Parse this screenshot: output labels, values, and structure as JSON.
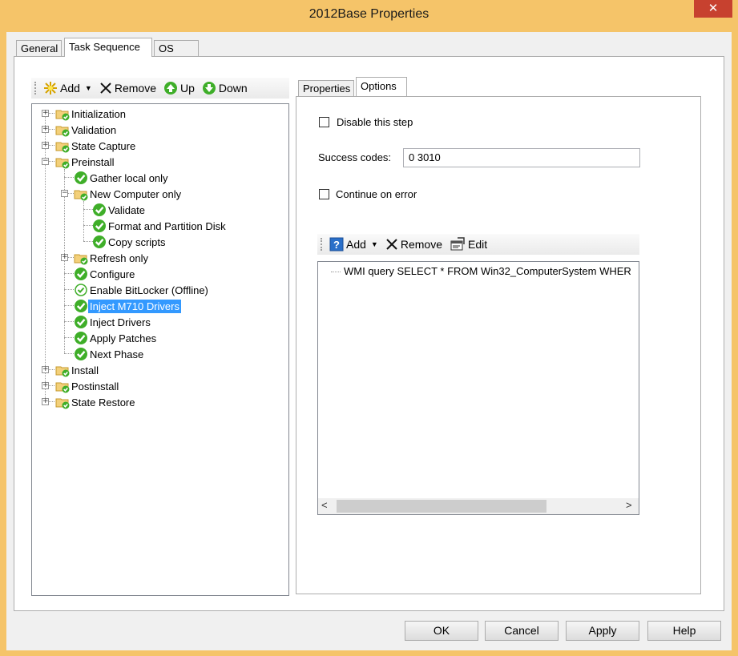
{
  "window": {
    "title": "2012Base Properties",
    "close_glyph": "✕",
    "accent": "#f5c469"
  },
  "main_tabs": [
    {
      "label": "General"
    },
    {
      "label": "Task Sequence"
    },
    {
      "label": "OS Info"
    }
  ],
  "seq_toolbar": {
    "add": "Add",
    "remove": "Remove",
    "up": "Up",
    "down": "Down"
  },
  "tree": [
    {
      "label": "Initialization",
      "icon": "folder-check-icon",
      "expander": "+"
    },
    {
      "label": "Validation",
      "icon": "folder-check-icon",
      "expander": "+"
    },
    {
      "label": "State Capture",
      "icon": "folder-check-icon",
      "expander": "+"
    },
    {
      "label": "Preinstall",
      "icon": "folder-check-icon",
      "expander": "−"
    },
    {
      "label": "Gather local only",
      "icon": "green-check-icon"
    },
    {
      "label": "New Computer only",
      "icon": "folder-check-icon",
      "expander": "−"
    },
    {
      "label": "Validate",
      "icon": "green-check-icon"
    },
    {
      "label": "Format and Partition Disk",
      "icon": "green-check-icon"
    },
    {
      "label": "Copy scripts",
      "icon": "green-check-icon"
    },
    {
      "label": "Refresh only",
      "icon": "folder-check-icon",
      "expander": "+"
    },
    {
      "label": "Configure",
      "icon": "green-check-icon"
    },
    {
      "label": "Enable BitLocker (Offline)",
      "icon": "disabled-check-icon"
    },
    {
      "label": "Inject M710 Drivers",
      "icon": "green-check-icon",
      "selected": true
    },
    {
      "label": "Inject Drivers",
      "icon": "green-check-icon"
    },
    {
      "label": "Apply Patches",
      "icon": "green-check-icon"
    },
    {
      "label": "Next Phase",
      "icon": "green-check-icon"
    },
    {
      "label": "Install",
      "icon": "folder-check-icon",
      "expander": "+"
    },
    {
      "label": "Postinstall",
      "icon": "folder-check-icon",
      "expander": "+"
    },
    {
      "label": "State Restore",
      "icon": "folder-check-icon",
      "expander": "+"
    }
  ],
  "right_tabs": [
    {
      "label": "Properties"
    },
    {
      "label": "Options"
    }
  ],
  "options": {
    "disable_step": "Disable this step",
    "success_codes_label": "Success codes:",
    "success_codes_value": "0 3010",
    "continue_on_error": "Continue on error"
  },
  "cond_toolbar": {
    "add": "Add",
    "remove": "Remove",
    "edit": "Edit"
  },
  "conditions": [
    "WMI query SELECT * FROM Win32_ComputerSystem WHER"
  ],
  "scroll": {
    "left_glyph": "<",
    "right_glyph": ">"
  },
  "buttons": {
    "ok": "OK",
    "cancel": "Cancel",
    "apply": "Apply",
    "help": "Help"
  }
}
